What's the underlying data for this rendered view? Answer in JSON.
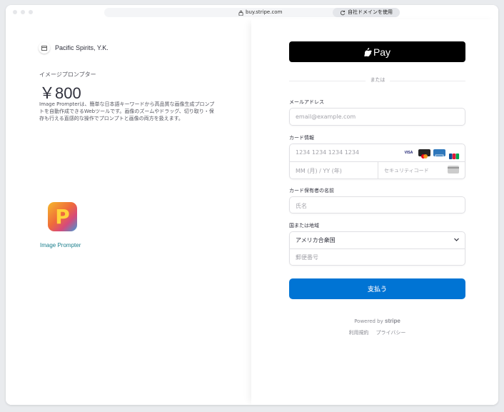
{
  "browser": {
    "url": "buy.stripe.com",
    "domain_button": "自社ドメインを使用"
  },
  "merchant": {
    "name": "Pacific Spirits, Y.K."
  },
  "product": {
    "name": "イメージプロンプター",
    "price": "￥800",
    "description": "Image Prompterは、簡単な日本語キーワードから高品質な画像生成プロンプトを自動作成できるWebツールです。画像のズームやドラッグ、切り取り・保存も行える直感的な操作でプロンプトと画像の両方を扱えます。",
    "logo_letter": "P",
    "logo_label": "Image Prompter"
  },
  "payment": {
    "apple_pay_label": "Pay",
    "divider_text": "または",
    "email_label": "メールアドレス",
    "email_placeholder": "email@example.com",
    "card_label": "カード情報",
    "card_number_placeholder": "1234 1234 1234 1234",
    "card_expiry_placeholder": "MM (月) / YY (年)",
    "card_cvc_placeholder": "セキュリティコード",
    "card_brands": [
      "VISA",
      "Mastercard",
      "Amex",
      "JCB"
    ],
    "cardholder_label": "カード保有者の名前",
    "cardholder_placeholder": "氏名",
    "country_label": "国または地域",
    "country_value": "アメリカ合衆国",
    "postal_placeholder": "郵便番号",
    "pay_button": "支払う"
  },
  "footer": {
    "powered_by": "Powered by",
    "stripe": "stripe",
    "terms": "利用規約",
    "privacy": "プライバシー"
  },
  "colors": {
    "pay_button": "#0074d4",
    "apple_pay": "#000000",
    "logo_label": "#1a7e8c"
  }
}
